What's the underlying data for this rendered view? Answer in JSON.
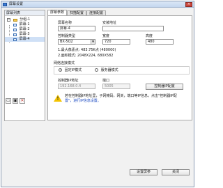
{
  "window": {
    "title": "屏幕设置",
    "close_label": "×"
  },
  "left_panel": {
    "header": "屏幕列表",
    "tree": {
      "group_expander": "−",
      "group_label": "分组-1",
      "screens": [
        "屏幕-1",
        "屏幕-2",
        "屏幕-3",
        "屏幕-4"
      ]
    },
    "tools": [
      {
        "name": "screen-add-icon",
        "glyph": "▭"
      },
      {
        "name": "folder-add-icon",
        "glyph": "▣"
      },
      {
        "name": "delete-icon",
        "glyph": "✕"
      }
    ]
  },
  "tabs": [
    "屏幕参数",
    "扫描配置",
    "连接配置"
  ],
  "active_tab": 0,
  "params": {
    "screen_name_label": "屏幕名称",
    "screen_name_value": "屏幕-4",
    "install_address_label": "安装地址",
    "install_address_value": "",
    "controller_type_label": "控制器类型",
    "controller_type_value": "BX-5Q2",
    "width_label": "宽度",
    "width_value": "720",
    "height_label": "高度",
    "height_value": "480",
    "info_line1": "1.最大像素点: 483.75K点 (480000)",
    "info_line2": "2.面积模式: 2048X224, 680X582",
    "network_group_label": "网络连接模式",
    "mode_fixed_label": "固定IP模式",
    "mode_server_label": "服务器模式",
    "ip_label": "控制器IP地址",
    "ip_value": "192.168.0.4",
    "port_label": "端口",
    "port_value": "5005",
    "ip_config_button": "控制器IP配置",
    "warning_text_line1": "若在控制器IP地址里，子网掩码，网关，端口等IP信息，点击\"控制器IP配",
    "warning_text_line2": "置\"，进行IP信息设置。"
  },
  "footer": {
    "settings_button": "设置屏参",
    "close_button": "关闭"
  },
  "colors": {
    "title_gradient_top": "#dbe7f6",
    "title_gradient_bottom": "#c4d7ef",
    "close_red": "#c9463d",
    "warning_yellow": "#f3c300",
    "link_blue": "#0b3dbd"
  }
}
